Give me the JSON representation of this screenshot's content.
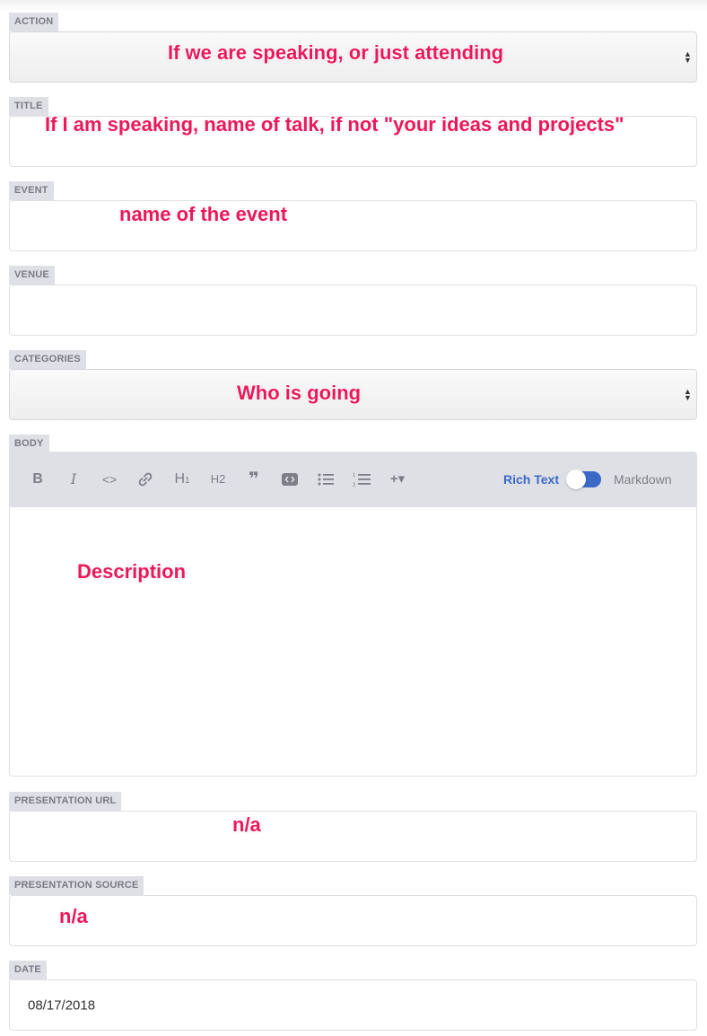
{
  "fields": {
    "action": {
      "label": "ACTION",
      "annotation": "If we are speaking, or just attending"
    },
    "title": {
      "label": "TITLE",
      "annotation": "If I am speaking, name of talk, if not \"your ideas and projects\""
    },
    "event": {
      "label": "EVENT",
      "annotation": "name of the event"
    },
    "venue": {
      "label": "VENUE",
      "value": ""
    },
    "categories": {
      "label": "CATEGORIES",
      "annotation": "Who is going"
    },
    "body": {
      "label": "BODY",
      "annotation": "Description",
      "toolbar": {
        "bold": "B",
        "italic": "I",
        "code": "<>",
        "link_icon": "link-icon",
        "h1": "H",
        "h1_sub": "1",
        "h2": "H",
        "h2_sub": "2",
        "quote": "❞",
        "code_block_icon": "code-block-icon",
        "bullet_list_icon": "bulleted-list-icon",
        "numbered_list_icon": "numbered-list-icon",
        "add": "+▾",
        "rich_text": "Rich Text",
        "markdown": "Markdown"
      }
    },
    "presentation_url": {
      "label": "PRESENTATION URL",
      "annotation": "n/a"
    },
    "presentation_source": {
      "label": "PRESENTATION SOURCE",
      "annotation": "n/a"
    },
    "date": {
      "label": "DATE",
      "value": "08/17/2018"
    }
  },
  "colors": {
    "annotation": "#e8195a",
    "label_bg": "#dfe0e5",
    "toggle": "#3a69c7"
  }
}
